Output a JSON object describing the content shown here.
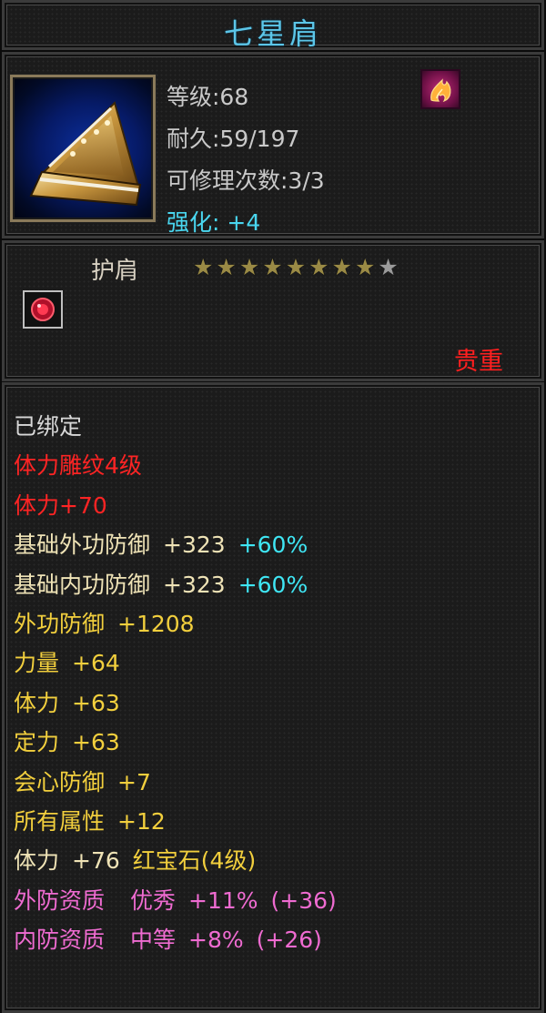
{
  "item": {
    "name": "七星肩",
    "info": {
      "level": "等级:68",
      "durability": "耐久:59/197",
      "repair": "可修理次数:3/3",
      "enhance_label": "强化:",
      "enhance_value": "+4"
    },
    "badge_icon": "flame-emblem-icon",
    "type": "护肩",
    "stars": {
      "total": 9,
      "filled": 8
    },
    "gem_icon": "red-gem-icon",
    "rarity": "贵重"
  },
  "attributes": {
    "bound": "已绑定",
    "engrave": "体力雕纹4级",
    "engrave_bonus": "体力+70",
    "base_ext_def": {
      "label": "基础外功防御",
      "value": "+323",
      "pct": "+60%"
    },
    "base_int_def": {
      "label": "基础内功防御",
      "value": "+323",
      "pct": "+60%"
    },
    "ext_def": {
      "label": "外功防御",
      "value": "+1208"
    },
    "strength": {
      "label": "力量",
      "value": "+64"
    },
    "stamina": {
      "label": "体力",
      "value": "+63"
    },
    "focus": {
      "label": "定力",
      "value": "+63"
    },
    "crit_def": {
      "label": "会心防御",
      "value": "+7"
    },
    "all_attr": {
      "label": "所有属性",
      "value": "+12"
    },
    "gem": {
      "label": "体力",
      "value": "+76",
      "gem_name": "红宝石(4级)"
    },
    "ext_quality": {
      "label": "外防资质",
      "grade": "优秀",
      "value": "+11%",
      "extra": "(+36)"
    },
    "int_quality": {
      "label": "内防资质",
      "grade": "中等",
      "value": "+8%",
      "extra": "(+26)"
    }
  },
  "colors": {
    "title": "#5cc6e8",
    "enhance": "#49d6ef",
    "rarity": "#ff1f1f",
    "engrave": "#ff2424",
    "attribute": "#f2cf3d",
    "percent": "#3fe6f4",
    "quality": "#ef6bd1"
  }
}
